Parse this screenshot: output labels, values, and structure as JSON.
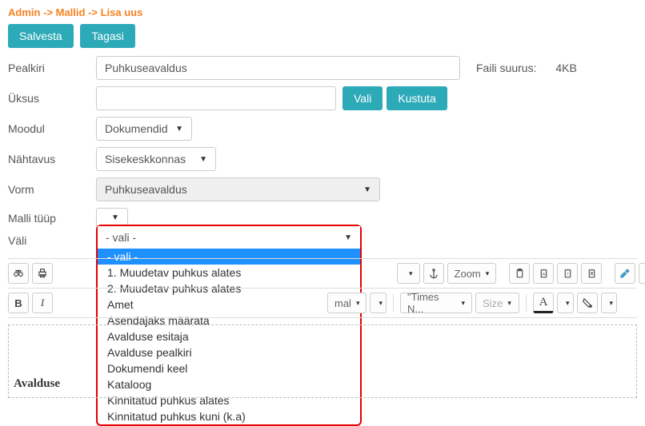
{
  "breadcrumb": {
    "part1": "Admin",
    "part2": "Mallid",
    "part3": "Lisa uus",
    "arrow": " -> "
  },
  "buttons": {
    "save": "Salvesta",
    "back": "Tagasi",
    "choose": "Vali",
    "delete": "Kustuta"
  },
  "labels": {
    "title": "Pealkiri",
    "unit": "Üksus",
    "module": "Moodul",
    "visibility": "Nähtavus",
    "form": "Vorm",
    "template_type": "Malli tüüp",
    "field": "Väli",
    "file_size_lbl": "Faili suurus:",
    "file_size_val": "4KB"
  },
  "values": {
    "title": "Puhkuseavaldus",
    "unit": "",
    "module": "Dokumendid",
    "visibility": "Sisekeskkonnas",
    "form": "Puhkuseavaldus",
    "template_type": ""
  },
  "field_dropdown": {
    "placeholder": "- vali -",
    "options": [
      "- vali -",
      "1. Muudetav puhkus alates",
      "2. Muudetav puhkus alates",
      "Amet",
      "Asendajaks määrata",
      "Avalduse esitaja",
      "Avalduse pealkiri",
      "Dokumendi keel",
      "Kataloog",
      "Kinnitatud puhkus alates",
      "Kinnitatud puhkus kuni (k.a)"
    ]
  },
  "toolbar": {
    "zoom": "Zoom",
    "styles2_text": "mal",
    "font": "\"Times N...",
    "size": "Size",
    "fontcolor": "A"
  },
  "document": {
    "heading_fragment": "Avalduse"
  }
}
